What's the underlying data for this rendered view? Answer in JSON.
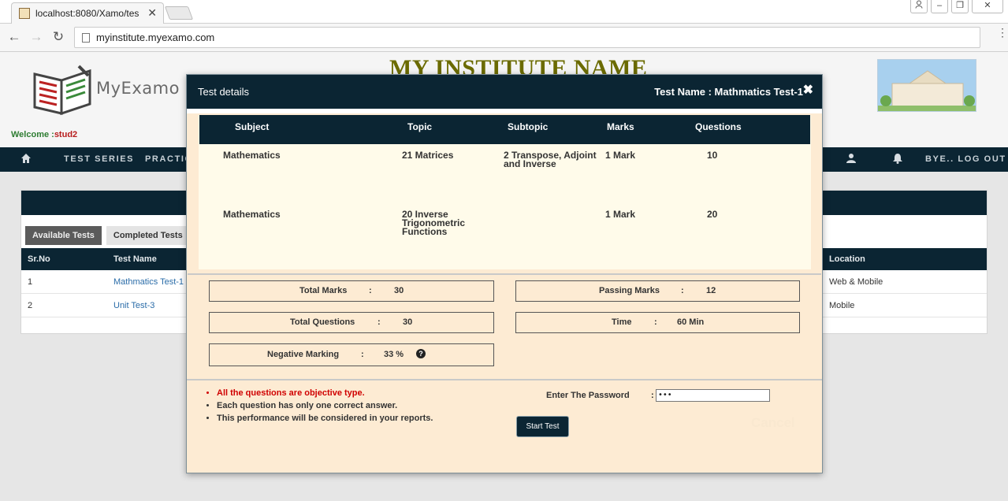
{
  "browser": {
    "tab_title": "localhost:8080/Xamo/tes",
    "tab_close": "✕",
    "url": "myinstitute.myexamo.com",
    "win_min": "–",
    "win_restore": "❐",
    "win_close": "✕",
    "back": "←",
    "forward": "→",
    "reload": "↻",
    "menu": "⋮"
  },
  "header": {
    "brand": "MyExamo",
    "institute_name": "MY INSTITUTE NAME",
    "welcome_label": "Welcome :",
    "welcome_user": "stud2"
  },
  "nav": {
    "items": [
      "TEST SERIES",
      "PRACTICE"
    ],
    "logout": "BYE.. LOG OUT"
  },
  "panel": {
    "tabs": [
      "Available Tests",
      "Completed Tests"
    ],
    "columns": {
      "srno": "Sr.No",
      "test_name": "Test Name",
      "location": "Location"
    },
    "rows": [
      {
        "srno": "1",
        "test_name": "Mathmatics Test-1",
        "location": "Web & Mobile"
      },
      {
        "srno": "2",
        "test_name": "Unit Test-3",
        "location": "Mobile"
      }
    ]
  },
  "modal": {
    "title": "Test details",
    "test_name": "Test Name : Mathmatics Test-1",
    "close": "✖",
    "columns": {
      "subject": "Subject",
      "topic": "Topic",
      "subtopic": "Subtopic",
      "marks": "Marks",
      "questions": "Questions"
    },
    "rows": [
      {
        "subject": "Mathematics",
        "topic": "21 Matrices",
        "subtopic": "2 Transpose, Adjoint and Inverse",
        "marks": "1 Mark",
        "questions": "10"
      },
      {
        "subject": "Mathematics",
        "topic": "20 Inverse Trigonometric Functions",
        "subtopic": "",
        "marks": "1 Mark",
        "questions": "20"
      }
    ],
    "summary": {
      "total_marks_label": "Total Marks",
      "total_marks": "30",
      "passing_marks_label": "Passing Marks",
      "passing_marks": "12",
      "total_questions_label": "Total Questions",
      "total_questions": "30",
      "time_label": "Time",
      "time": "60 Min",
      "negative_marking_label": "Negative Marking",
      "negative_marking": "33 %",
      "colon": ":",
      "help": "?"
    },
    "rules": [
      "All the questions are objective type.",
      "Each question has only one correct answer.",
      "This performance will be considered in your reports."
    ],
    "password_label": "Enter The Password",
    "password_value": "•••",
    "start_button": "Start Test",
    "cancel_button": "Cancel"
  }
}
